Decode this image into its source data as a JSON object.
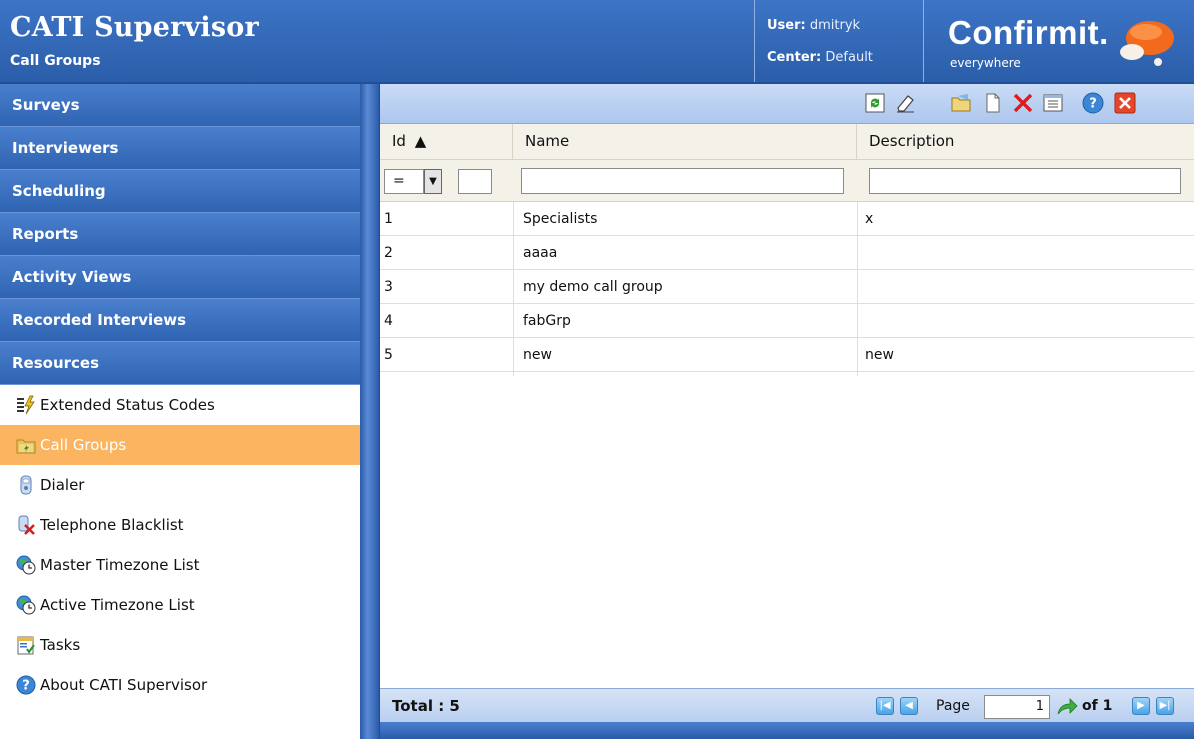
{
  "header": {
    "app_title": "CATI Supervisor",
    "page_subtitle": "Call Groups",
    "user_label": "User:",
    "user_value": "dmitryk",
    "center_label": "Center:",
    "center_value": "Default",
    "logo_text": "Confirmit.",
    "logo_sub": "everywhere"
  },
  "sidebar": {
    "sections": [
      "Surveys",
      "Interviewers",
      "Scheduling",
      "Reports",
      "Activity Views",
      "Recorded Interviews",
      "Resources"
    ],
    "items": [
      {
        "label": "Extended Status Codes",
        "icon": "status-codes-icon"
      },
      {
        "label": "Call Groups",
        "icon": "call-groups-folder-icon",
        "active": true
      },
      {
        "label": "Dialer",
        "icon": "dialer-icon"
      },
      {
        "label": "Telephone Blacklist",
        "icon": "telephone-blacklist-icon"
      },
      {
        "label": "Master Timezone List",
        "icon": "globe-clock-icon"
      },
      {
        "label": "Active Timezone List",
        "icon": "globe-clock-icon"
      },
      {
        "label": "Tasks",
        "icon": "tasks-icon"
      },
      {
        "label": "About CATI Supervisor",
        "icon": "help-icon"
      }
    ]
  },
  "toolbar": {
    "buttons": [
      "refresh-icon",
      "clear-filter-icon",
      "edit-icon",
      "new-icon",
      "delete-icon",
      "columns-icon",
      "help-icon",
      "close-icon"
    ]
  },
  "grid": {
    "columns": [
      "Id",
      "Name",
      "Description"
    ],
    "sort_indicator": "▲",
    "filter_operator": "=",
    "rows": [
      {
        "id": "1",
        "name": "Specialists",
        "description": "x"
      },
      {
        "id": "2",
        "name": "aaaa",
        "description": ""
      },
      {
        "id": "3",
        "name": "my demo call group",
        "description": ""
      },
      {
        "id": "4",
        "name": "fabGrp",
        "description": ""
      },
      {
        "id": "5",
        "name": "new",
        "description": "new"
      }
    ]
  },
  "footer": {
    "total": "Total : 5",
    "page_label": "Page",
    "page_value": "1",
    "of_label": "of 1"
  },
  "colors": {
    "header_blue": "#2b5ea9",
    "active_item": "#fbb560",
    "grid_header": "#f3f1e8"
  }
}
